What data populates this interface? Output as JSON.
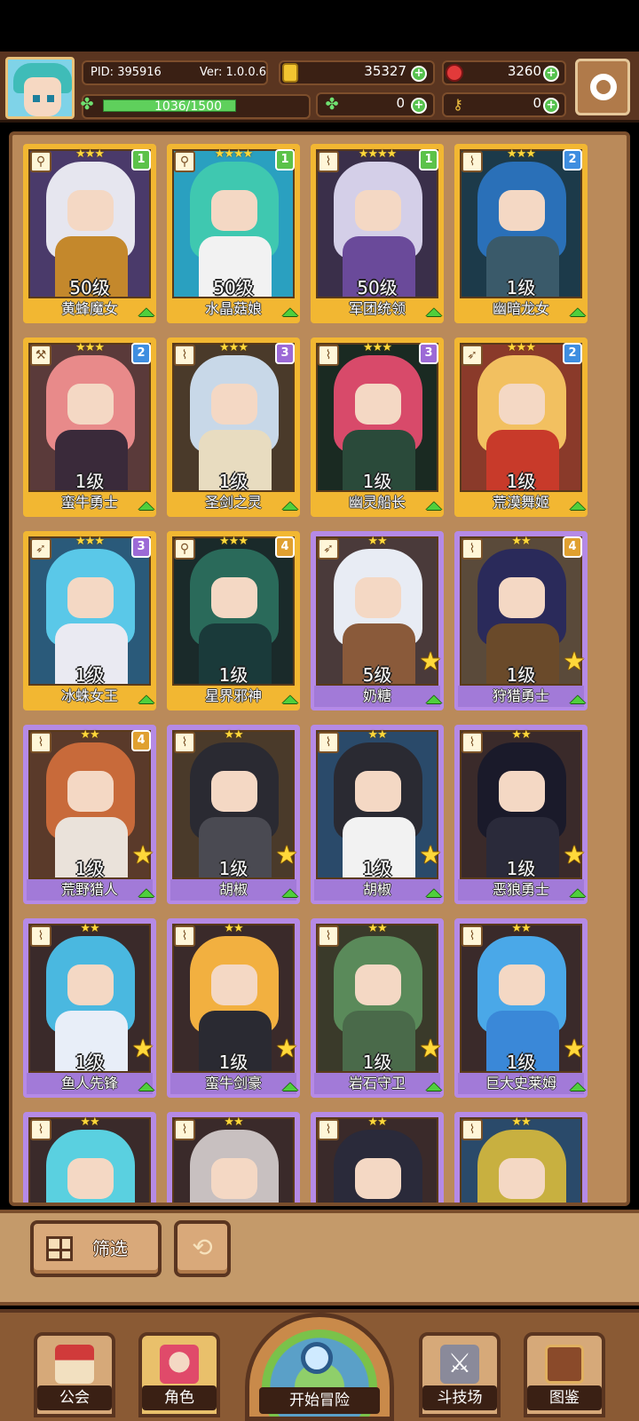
{
  "header": {
    "pid": "PID: 395916",
    "version": "Ver: 1.0.0.6",
    "gold": "35327",
    "gems": "3260",
    "energy": "1036/1500",
    "energy_fraction": 0.69,
    "clover": "0",
    "keys": "0"
  },
  "cards": [
    {
      "name": "黄蜂魔女",
      "level": "50级",
      "stars": "★★★",
      "rank": "1",
      "frame": "gold",
      "hair": "#e6e6ef",
      "body": "#c4882c",
      "bg": "#4a3a6a",
      "weapon": "wand"
    },
    {
      "name": "水晶菇娘",
      "level": "50级",
      "stars": "★★★★",
      "rank": "1",
      "frame": "gold",
      "hair": "#3fc8b0",
      "body": "#f2f2f2",
      "bg": "#2aa0c0",
      "weapon": "wand"
    },
    {
      "name": "军团统领",
      "level": "50级",
      "stars": "★★★★",
      "rank": "1",
      "frame": "gold",
      "hair": "#d4cfe8",
      "body": "#6a4a9a",
      "bg": "#3a2f4a",
      "weapon": "horn"
    },
    {
      "name": "幽暗龙女",
      "level": "1级",
      "stars": "★★★",
      "rank": "2",
      "frame": "gold",
      "hair": "#2a70b8",
      "body": "#3a5a6a",
      "bg": "#1c3a4a",
      "weapon": "horn"
    },
    {
      "name": "蛮牛勇士",
      "level": "1级",
      "stars": "★★★",
      "rank": "2",
      "frame": "gold",
      "hair": "#e88a8a",
      "body": "#3a2a3a",
      "bg": "#5a3a3a",
      "weapon": "axe"
    },
    {
      "name": "圣剑之灵",
      "level": "1级",
      "stars": "★★★",
      "rank": "3",
      "frame": "gold",
      "hair": "#c8d8e8",
      "body": "#e8dcc0",
      "bg": "#4a3a2a",
      "weapon": "horn"
    },
    {
      "name": "幽灵船长",
      "level": "1级",
      "stars": "★★★",
      "rank": "3",
      "frame": "gold",
      "hair": "#d84a6a",
      "body": "#2a4a3a",
      "bg": "#1a2a22",
      "weapon": "horn"
    },
    {
      "name": "荒漠舞姬",
      "level": "1级",
      "stars": "★★★",
      "rank": "2",
      "frame": "gold",
      "hair": "#f2c060",
      "body": "#c83a2a",
      "bg": "#8a3a2a",
      "weapon": "bow"
    },
    {
      "name": "冰蛛女王",
      "level": "1级",
      "stars": "★★★",
      "rank": "3",
      "frame": "gold",
      "hair": "#5ac8e8",
      "body": "#eaeaf2",
      "bg": "#2a5a7a",
      "weapon": "bow"
    },
    {
      "name": "星界邪神",
      "level": "1级",
      "stars": "★★★",
      "rank": "4",
      "frame": "gold",
      "hair": "#2a6a5a",
      "body": "#1a3a3a",
      "bg": "#1a2a2a",
      "weapon": "wand"
    },
    {
      "name": "奶糖",
      "level": "5级",
      "stars": "★★",
      "rank": "",
      "frame": "purple",
      "hair": "#e8ecf4",
      "body": "#8a5a3a",
      "bg": "#4a3a3a",
      "weapon": "bow"
    },
    {
      "name": "狩猎勇士",
      "level": "1级",
      "stars": "★★",
      "rank": "4",
      "frame": "purple",
      "hair": "#2a2a5a",
      "body": "#6a4a2a",
      "bg": "#5a4a3a",
      "weapon": "horn"
    },
    {
      "name": "荒野猎人",
      "level": "1级",
      "stars": "★★",
      "rank": "4",
      "frame": "purple",
      "hair": "#c86a3a",
      "body": "#eae2da",
      "bg": "#5a3a2a",
      "weapon": "horn"
    },
    {
      "name": "胡椒",
      "level": "1级",
      "stars": "★★",
      "rank": "",
      "frame": "purple",
      "hair": "#2a2a32",
      "body": "#4a4a52",
      "bg": "#4a3a2a",
      "weapon": "horn"
    },
    {
      "name": "胡椒",
      "level": "1级",
      "stars": "★★",
      "rank": "",
      "frame": "purple",
      "hair": "#2a2a32",
      "body": "#f2f2f2",
      "bg": "#2a4a6a",
      "weapon": "horn"
    },
    {
      "name": "恶狼勇士",
      "level": "1级",
      "stars": "★★",
      "rank": "",
      "frame": "purple",
      "hair": "#1a1a2a",
      "body": "#2a2a3a",
      "bg": "#3a2a2a",
      "weapon": "horn"
    },
    {
      "name": "鱼人先锋",
      "level": "1级",
      "stars": "★★",
      "rank": "",
      "frame": "purple",
      "hair": "#4ab8e0",
      "body": "#e8eef8",
      "bg": "#3a2a2a",
      "weapon": "horn"
    },
    {
      "name": "蛮牛剑豪",
      "level": "1级",
      "stars": "★★",
      "rank": "",
      "frame": "purple",
      "hair": "#f2b040",
      "body": "#2a2a32",
      "bg": "#3a2a2a",
      "weapon": "horn"
    },
    {
      "name": "岩石守卫",
      "level": "1级",
      "stars": "★★",
      "rank": "",
      "frame": "purple",
      "hair": "#5a8a5a",
      "body": "#4a6a4a",
      "bg": "#3a3a2a",
      "weapon": "horn"
    },
    {
      "name": "巨大史莱姆",
      "level": "1级",
      "stars": "★★",
      "rank": "",
      "frame": "purple",
      "hair": "#4aa8e8",
      "body": "#3a88d8",
      "bg": "#3a2a2a",
      "weapon": "horn"
    },
    {
      "name": "",
      "level": "",
      "stars": "★★",
      "rank": "",
      "frame": "purple",
      "hair": "#5ad0e0",
      "body": "#3ab0c8",
      "bg": "#3a2a2a",
      "weapon": "horn"
    },
    {
      "name": "",
      "level": "",
      "stars": "★★",
      "rank": "",
      "frame": "purple",
      "hair": "#c8c0c0",
      "body": "#4a4a4a",
      "bg": "#3a2a2a",
      "weapon": "horn"
    },
    {
      "name": "",
      "level": "",
      "stars": "★★",
      "rank": "",
      "frame": "purple",
      "hair": "#2a2a3a",
      "body": "#4a7a6a",
      "bg": "#3a2a2a",
      "weapon": "horn"
    },
    {
      "name": "",
      "level": "",
      "stars": "★★",
      "rank": "",
      "frame": "purple",
      "hair": "#c8b040",
      "body": "#3a6a8a",
      "bg": "#2a4a6a",
      "weapon": "horn"
    }
  ],
  "filter": {
    "label": "筛选"
  },
  "nav": {
    "guild": "公会",
    "character": "角色",
    "adventure": "开始冒险",
    "arena": "斗技场",
    "codex": "图鉴"
  }
}
